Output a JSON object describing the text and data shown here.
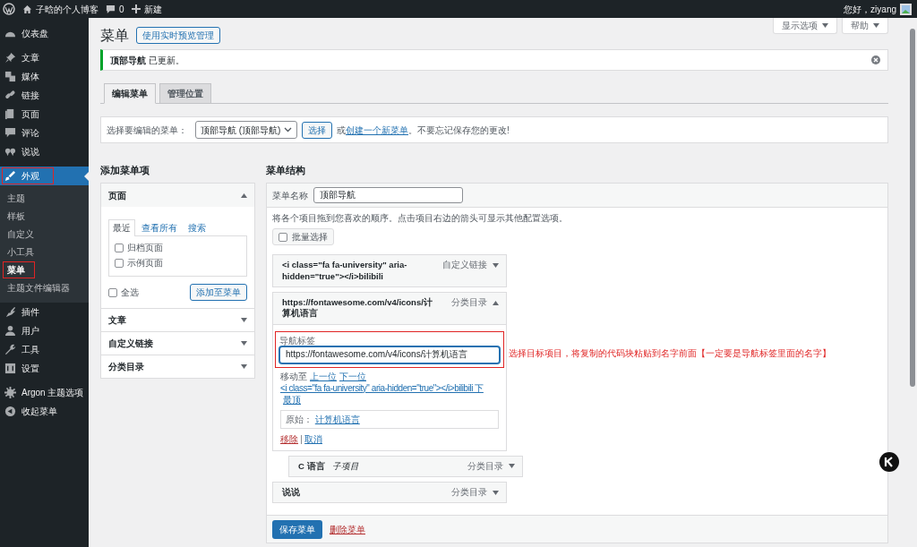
{
  "admin_bar": {
    "site": "子晗的个人博客",
    "comments": "0",
    "new": "新建",
    "greeting": "您好，ziyang"
  },
  "sidebar": {
    "sections": [
      {
        "items": [
          {
            "label": "仪表盘",
            "selected": false,
            "highlighted": false
          }
        ]
      },
      {
        "items": [
          {
            "label": "文章",
            "selected": false,
            "highlighted": false
          },
          {
            "label": "媒体",
            "selected": false,
            "highlighted": false
          },
          {
            "label": "链接",
            "selected": false,
            "highlighted": false
          },
          {
            "label": "页面",
            "selected": false,
            "highlighted": false
          },
          {
            "label": "评论",
            "selected": false,
            "highlighted": false
          },
          {
            "label": "说说",
            "selected": false,
            "highlighted": false
          }
        ]
      },
      {
        "items": [
          {
            "label": "外观",
            "selected": true,
            "highlighted": true,
            "children": [
              {
                "label": "主题",
                "selected": false,
                "highlighted": false
              },
              {
                "label": "样板",
                "selected": false,
                "highlighted": false
              },
              {
                "label": "自定义",
                "selected": false,
                "highlighted": false
              },
              {
                "label": "小工具",
                "selected": false,
                "highlighted": false
              },
              {
                "label": "菜单",
                "selected": true,
                "highlighted": true
              },
              {
                "label": "主题文件编辑器",
                "selected": false,
                "highlighted": false
              }
            ]
          },
          {
            "label": "插件",
            "selected": false,
            "highlighted": false
          },
          {
            "label": "用户",
            "selected": false,
            "highlighted": false
          },
          {
            "label": "工具",
            "selected": false,
            "highlighted": false
          },
          {
            "label": "设置",
            "selected": false,
            "highlighted": false
          }
        ]
      },
      {
        "items": [
          {
            "label": "Argon 主题选项",
            "selected": false,
            "highlighted": false
          },
          {
            "label": "收起菜单",
            "selected": false,
            "highlighted": false
          }
        ]
      }
    ]
  },
  "screen_tabs": [
    "显示选项",
    "帮助"
  ],
  "page_title": "菜单",
  "title_button": "使用实时预览管理",
  "notice": "**顶部导航** 已更新。",
  "tabs": [
    {
      "label": "编辑菜单",
      "selected": true
    },
    {
      "label": "管理位置",
      "selected": false
    }
  ],
  "select_bar": {
    "label": "选择要编辑的菜单：",
    "value": "顶部导航 (顶部导航)",
    "button": "选择",
    "prefix": "或",
    "link": "创建一个新菜单",
    "suffix": "。不要忘记保存您的更改!"
  },
  "add_items": {
    "heading": "添加菜单项",
    "sections": [
      {
        "title": "页面",
        "expanded": true,
        "tabs": [
          {
            "label": "最近",
            "selected": true
          },
          {
            "label": "查看所有",
            "selected": false
          },
          {
            "label": "搜索",
            "selected": false
          }
        ],
        "items": [
          {
            "label": "归档页面",
            "checked": false
          },
          {
            "label": "示例页面",
            "checked": false
          }
        ],
        "select_all": {
          "label": "全选",
          "checked": false
        },
        "button": "添加至菜单"
      },
      {
        "title": "文章",
        "expanded": false
      },
      {
        "title": "自定义链接",
        "expanded": false
      },
      {
        "title": "分类目录",
        "expanded": false
      }
    ]
  },
  "structure": {
    "heading": "菜单结构",
    "name_label": "菜单名称",
    "name_value": "顶部导航",
    "instructions": "将各个项目拖到您喜欢的顺序。点击项目右边的箭头可显示其他配置选项。",
    "bulk_select": {
      "label": "批量选择",
      "checked": false
    },
    "items": [
      {
        "title": "<i class=\"fa fa-university\" aria-hidden=\"true\"></i>bilibili",
        "type": "自定义链接",
        "expanded": false
      },
      {
        "title": "https://fontawesome.com/v4/icons/计算机语言",
        "type": "分类目录",
        "expanded": true,
        "edit": {
          "label_caption": "导航标签",
          "label_value": "https://fontawesome.com/v4/icons/计算机语言",
          "highlighted": true,
          "annotation": "选择目标项目，将复制的代码块粘贴到名字前面【一定要是导航标签里面的名字】",
          "move_label": "移动至",
          "move_links": [
            "上一位",
            "下一位",
            "<i class=\"fa fa-university\" aria-hidden=\"true\"></i>bilibili 下",
            "最顶"
          ],
          "original_label": "原始：",
          "original_link": "计算机语言",
          "remove": "移除",
          "cancel": "取消"
        },
        "children": [
          {
            "title": "C 语言",
            "sub_label": "子项目",
            "type": "分类目录",
            "expanded": false
          }
        ]
      },
      {
        "title": "说说",
        "type": "分类目录",
        "expanded": false
      }
    ],
    "save_button": "保存菜单",
    "delete_link": "删除菜单"
  }
}
